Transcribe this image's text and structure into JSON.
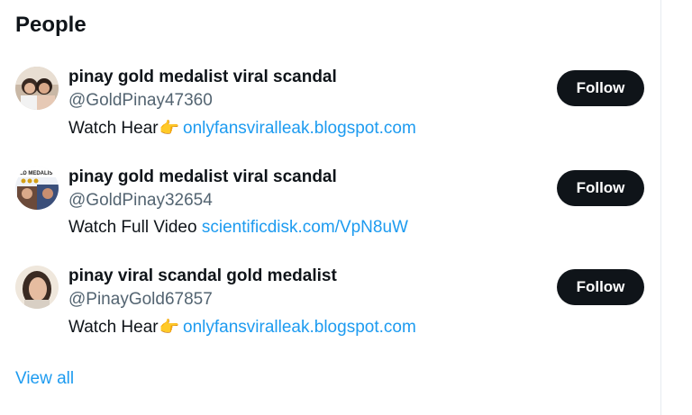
{
  "section": {
    "title": "People",
    "view_all_label": "View all"
  },
  "people": [
    {
      "name": "pinay gold medalist viral scandal",
      "handle": "@GoldPinay47360",
      "bio_text": "Watch Hear",
      "bio_emoji": "👉",
      "bio_link": "onlyfansviralleak.blogspot.com",
      "follow_label": "Follow"
    },
    {
      "name": "pinay gold medalist viral scandal",
      "handle": "@GoldPinay32654",
      "bio_text": "Watch Full Video ",
      "bio_emoji": "",
      "bio_link": "scientificdisk.com/VpN8uW",
      "follow_label": "Follow"
    },
    {
      "name": "pinay viral scandal gold medalist",
      "handle": "@PinayGold67857",
      "bio_text": "Watch Hear",
      "bio_emoji": "👉",
      "bio_link": "onlyfansviralleak.blogspot.com",
      "follow_label": "Follow"
    }
  ],
  "colors": {
    "accent": "#1d9bf0",
    "button_bg": "#0f1419",
    "secondary_text": "#536471"
  }
}
